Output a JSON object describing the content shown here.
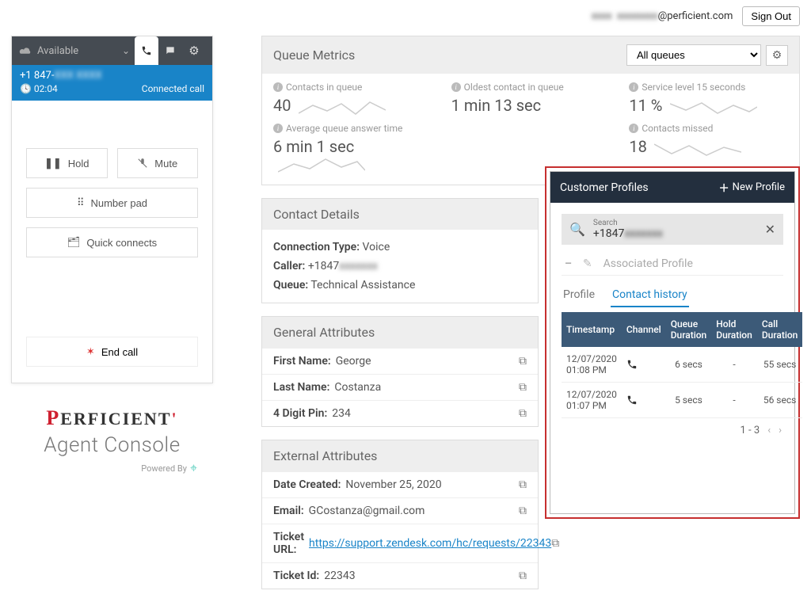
{
  "top": {
    "email_hidden": "blurred",
    "email_domain": "@perficient.com",
    "sign_out": "Sign Out"
  },
  "phone": {
    "status": "Available",
    "number_prefix": "+1 847-",
    "timer": "02:04",
    "conn_state": "Connected call",
    "hold": "Hold",
    "mute": "Mute",
    "number_pad": "Number pad",
    "quick_connects": "Quick connects",
    "end_call": "End call"
  },
  "brand": {
    "logo": "PERFICIENT",
    "subtitle": "Agent Console",
    "powered": "Powered By"
  },
  "metrics": {
    "title": "Queue Metrics",
    "queue_selected": "All queues",
    "row1": [
      {
        "label": "Contacts in queue",
        "value": "40"
      },
      {
        "label": "Oldest contact in queue",
        "value": "1 min 13 sec"
      },
      {
        "label": "Service level 15 seconds",
        "value": "11 %"
      }
    ],
    "row2": [
      {
        "label": "Average queue answer time",
        "value": "6 min 1 sec"
      },
      {
        "label": "",
        "value": ""
      },
      {
        "label": "Contacts missed",
        "value": "18"
      }
    ]
  },
  "contact": {
    "title": "Contact Details",
    "conn_type_label": "Connection Type:",
    "conn_type": "Voice",
    "caller_label": "Caller:",
    "caller_prefix": "+1847",
    "queue_label": "Queue:",
    "queue": "Technical Assistance"
  },
  "general": {
    "title": "General Attributes",
    "rows": [
      {
        "k": "First Name:",
        "v": "George"
      },
      {
        "k": "Last Name:",
        "v": "Costanza"
      },
      {
        "k": "4 Digit Pin:",
        "v": "234"
      }
    ]
  },
  "external": {
    "title": "External Attributes",
    "rows": [
      {
        "k": "Date Created:",
        "v": "November 25, 2020",
        "link": false
      },
      {
        "k": "Email:",
        "v": "GCostanza@gmail.com",
        "link": false
      },
      {
        "k": "Ticket URL:",
        "v": "https://support.zendesk.com/hc/requests/22343",
        "link": true
      },
      {
        "k": "Ticket Id:",
        "v": "22343",
        "link": false
      }
    ]
  },
  "cp": {
    "title": "Customer Profiles",
    "new_profile": "New Profile",
    "search_label": "Search",
    "search_prefix": "+1847",
    "associated": "Associated Profile",
    "tab_profile": "Profile",
    "tab_history": "Contact history",
    "headers": [
      "Timestamp",
      "Channel",
      "Queue Duration",
      "Hold Duration",
      "Call Duration"
    ],
    "rows": [
      {
        "ts": "12/07/2020 01:08 PM",
        "qd": "6 secs",
        "hd": "-",
        "cd": "55 secs"
      },
      {
        "ts": "12/07/2020 01:07 PM",
        "qd": "5 secs",
        "hd": "-",
        "cd": "56 secs"
      }
    ],
    "pager": "1 - 3"
  }
}
